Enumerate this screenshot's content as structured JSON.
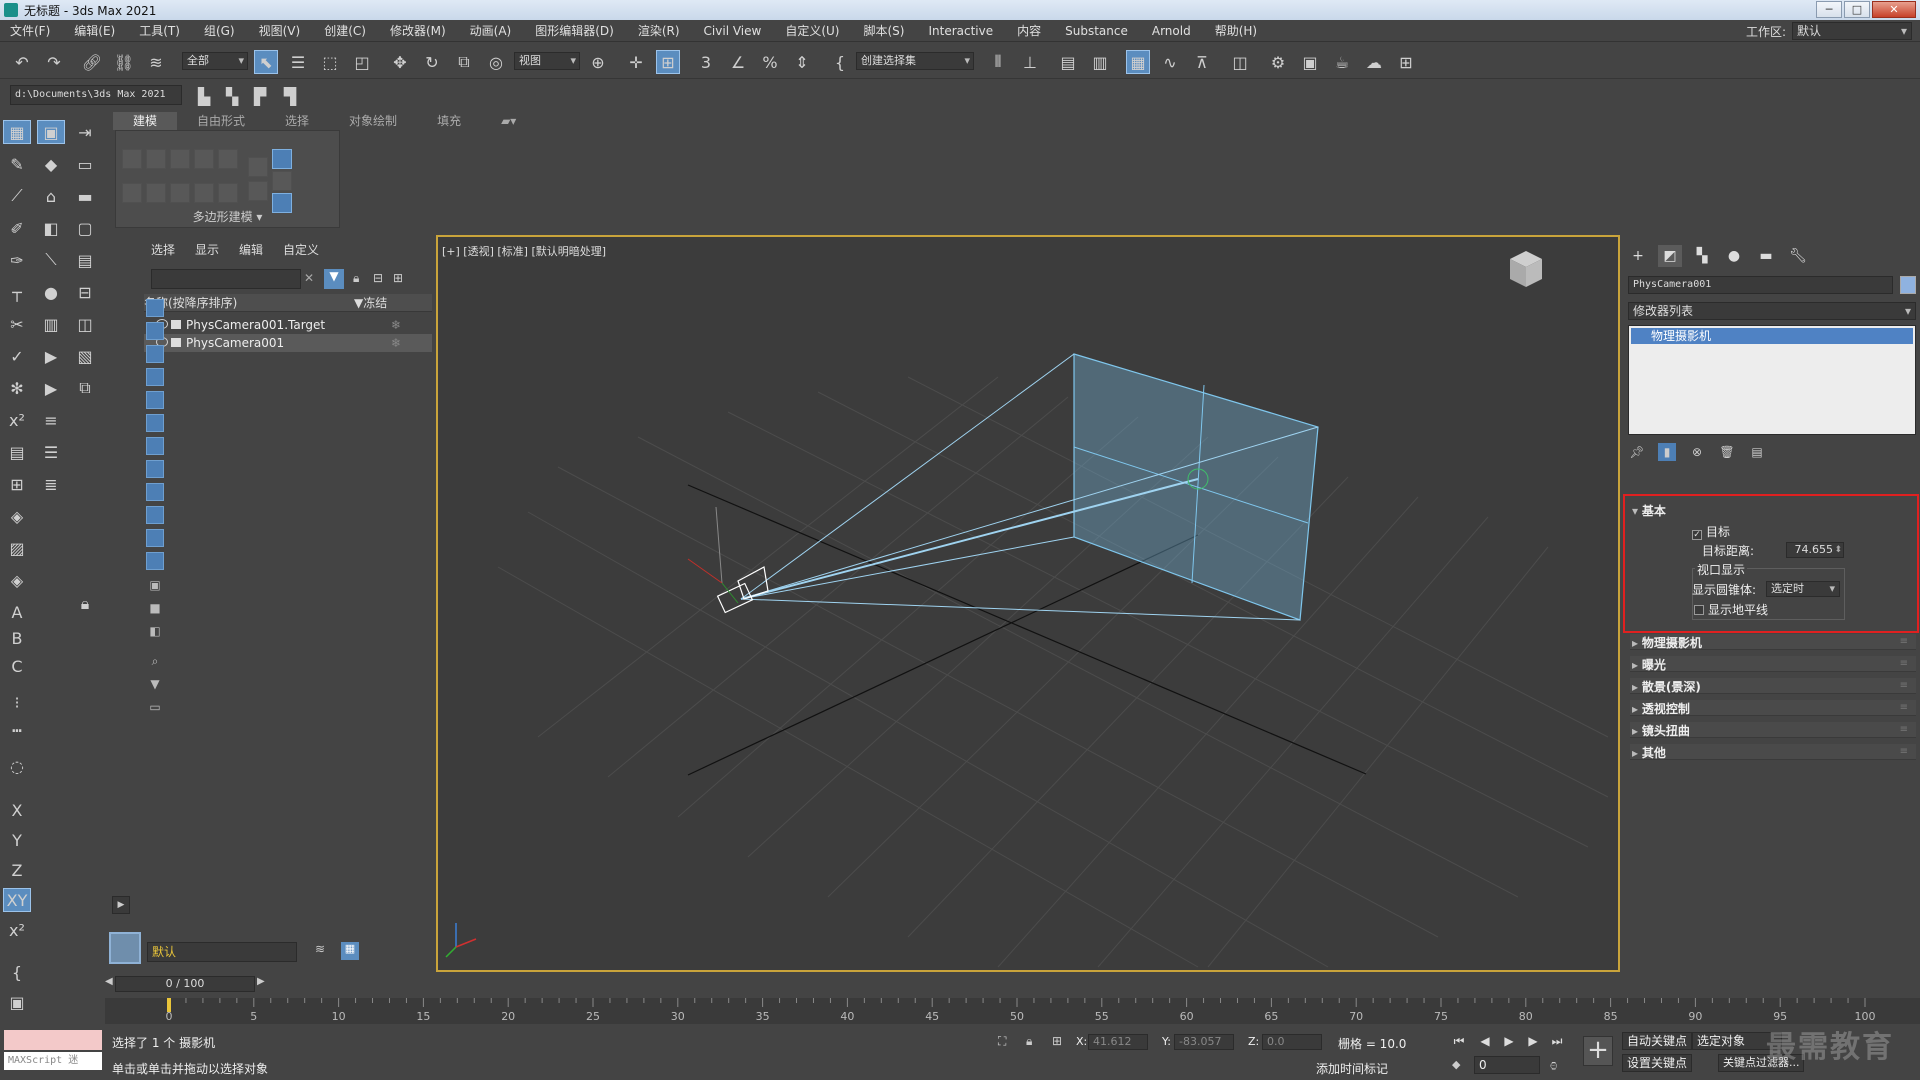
{
  "window": {
    "title": "无标题 - 3ds Max 2021",
    "minimize": "─",
    "maximize": "□",
    "close": "✕"
  },
  "menu": [
    "文件(F)",
    "编辑(E)",
    "工具(T)",
    "组(G)",
    "视图(V)",
    "创建(C)",
    "修改器(M)",
    "动画(A)",
    "图形编辑器(D)",
    "渲染(R)",
    "Civil View",
    "自定义(U)",
    "脚本(S)",
    "Interactive",
    "内容",
    "Substance",
    "Arnold",
    "帮助(H)"
  ],
  "workspace": {
    "label": "工作区:",
    "value": "默认"
  },
  "toolbar": {
    "selection_filter": "全部",
    "ref_coord": "视图",
    "named_selection": "创建选择集"
  },
  "project_path": "d:\\Documents\\3ds Max 2021",
  "ribbon": {
    "tabs": [
      "建模",
      "自由形式",
      "选择",
      "对象绘制",
      "填充"
    ],
    "panel_label": "多边形建模 ▾"
  },
  "scene_explorer": {
    "menu": [
      "选择",
      "显示",
      "编辑",
      "自定义"
    ],
    "column_name": "名称(按降序排序)",
    "column_freeze": "▼冻结",
    "rows": [
      {
        "name": "PhysCamera001.Target",
        "selected": false
      },
      {
        "name": "PhysCamera001",
        "selected": true
      }
    ],
    "layer": "默认"
  },
  "viewport": {
    "label": "[+] [透视] [标准] [默认明暗处理]"
  },
  "command_panel": {
    "object_name": "PhysCamera001",
    "modifier_list": "修改器列表",
    "stack_item": "物理摄影机",
    "basic": {
      "title": "基本",
      "target_label": "目标",
      "target_checked": true,
      "target_distance_label": "目标距离:",
      "target_distance": "74.655",
      "viewport_display_label": "视口显示",
      "show_cone_label": "显示圆锥体:",
      "show_cone_value": "选定时",
      "show_horizon_label": "显示地平线",
      "show_horizon_checked": false
    },
    "rollouts": [
      "物理摄影机",
      "曝光",
      "散景(景深)",
      "透视控制",
      "镜头扭曲",
      "其他"
    ]
  },
  "time": {
    "frame": "0 / 100",
    "ticks": [
      0,
      5,
      10,
      15,
      20,
      25,
      30,
      35,
      40,
      45,
      50,
      55,
      60,
      65,
      70,
      75,
      80,
      85,
      90,
      95,
      100
    ]
  },
  "status": {
    "maxscript": "MAXScript 迷",
    "selection_msg": "选择了 1 个 摄影机",
    "prompt_msg": "单击或单击并拖动以选择对象",
    "x_label": "X:",
    "x": "41.612",
    "y_label": "Y:",
    "y": "-83.057",
    "z_label": "Z:",
    "z": "0.0",
    "grid": "栅格 = 10.0",
    "add_time_tag": "添加时间标记",
    "auto_key": "自动关键点",
    "set_key": "设置关键点",
    "selected_obj": "选定对象",
    "key_filters": "关键点过滤器...",
    "current_frame": "0",
    "watermark": "最需教育"
  }
}
